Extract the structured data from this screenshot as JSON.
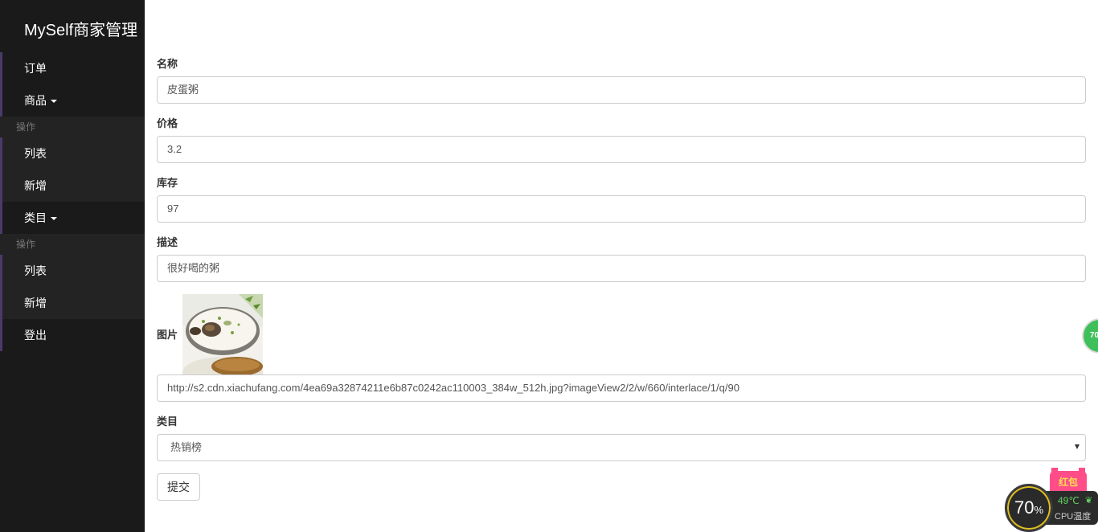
{
  "sidebar": {
    "brand": "MySelf商家管理",
    "items": [
      {
        "label": "订单"
      },
      {
        "label": "商品",
        "dropdown": true,
        "header": "操作",
        "children": [
          {
            "label": "列表"
          },
          {
            "label": "新增"
          }
        ]
      },
      {
        "label": "类目",
        "dropdown": true,
        "header": "操作",
        "children": [
          {
            "label": "列表"
          },
          {
            "label": "新增"
          }
        ]
      },
      {
        "label": "登出"
      }
    ]
  },
  "form": {
    "name_label": "名称",
    "name_value": "皮蛋粥",
    "price_label": "价格",
    "price_value": "3.2",
    "stock_label": "库存",
    "stock_value": "97",
    "desc_label": "描述",
    "desc_value": "很好喝的粥",
    "image_label": "图片",
    "image_url": "http://s2.cdn.xiachufang.com/4ea69a32874211e6b87c0242ac110003_384w_512h.jpg?imageView2/2/w/660/interlace/1/q/90",
    "category_label": "类目",
    "category_value": "热销榜",
    "submit_label": "提交"
  },
  "overlay": {
    "float_ball_text": "70",
    "cpu_percent": "70",
    "cpu_percent_unit": "%",
    "cpu_temp": "49℃",
    "cpu_label": "CPU温度",
    "hongbao_text": "红包"
  },
  "colors": {
    "sidebar_bg": "#1a1a1a",
    "sidebar_accent": "#4a3a6b",
    "sidebar_sub_bg": "#232323"
  }
}
